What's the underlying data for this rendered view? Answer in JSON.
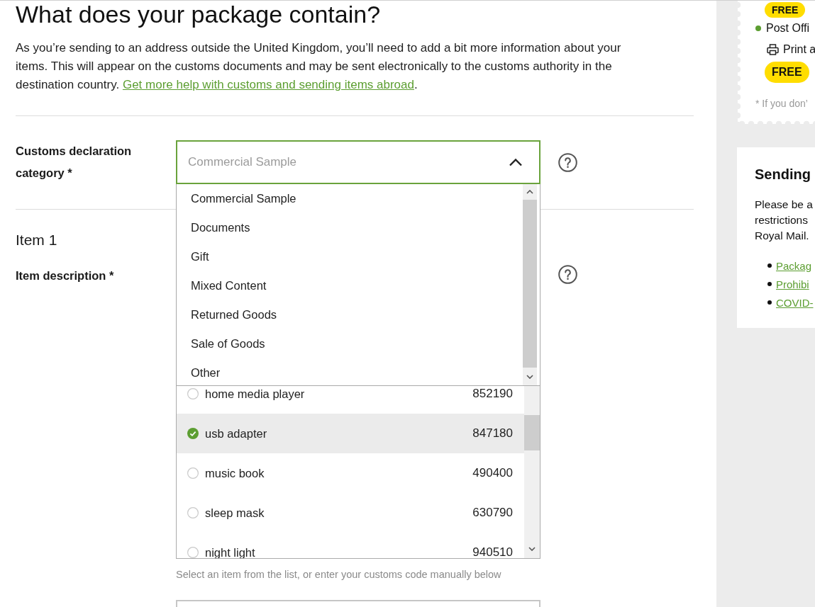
{
  "page_title": "What does your package contain?",
  "intro": {
    "text": "As you’re sending to an address outside the United Kingdom, you’ll need to add a bit more information about your items. This will appear on the customs documents and may be sent electronically to the customs authority in the destination country.",
    "link": "Get more help with customs and sending items abroad",
    "text_after": "."
  },
  "customs_category": {
    "label": "Customs declaration category *",
    "placeholder": "Commercial Sample",
    "expanded": true,
    "options": [
      {
        "label": "Commercial Sample",
        "selected": false
      },
      {
        "label": "Documents",
        "selected": false
      },
      {
        "label": "Gift",
        "selected": false
      },
      {
        "label": "Mixed Content",
        "selected": false
      },
      {
        "label": "Returned Goods",
        "selected": false
      },
      {
        "label": "Sale of Goods",
        "selected": false
      },
      {
        "label": "Other",
        "selected": false
      }
    ]
  },
  "item": {
    "title": "Item 1",
    "description_label": "Item description *",
    "results": [
      {
        "description": "home media player",
        "code": "852190",
        "selected": false
      },
      {
        "description": "usb adapter",
        "code": "847180",
        "selected": true
      },
      {
        "description": "music book",
        "code": "490400",
        "selected": false
      },
      {
        "description": "sleep mask",
        "code": "630790",
        "selected": false
      },
      {
        "description": "night light",
        "code": "940510",
        "selected": false
      }
    ],
    "hint": "Select an item from the list, or enter your customs code manually below"
  },
  "sidebar": {
    "delivery_card": {
      "top_badge": "FREE",
      "options": [
        {
          "kind": "dropoff",
          "label": "Post Offi"
        },
        {
          "kind": "print",
          "label": "Print a"
        }
      ],
      "price_badge": "FREE",
      "footnote": "* If you don’"
    },
    "info_card": {
      "title": "Sending",
      "lines": [
        "Please be a",
        "restrictions",
        "Royal Mail."
      ],
      "links": [
        "Packag",
        "Prohibi",
        "COVID-"
      ]
    }
  }
}
